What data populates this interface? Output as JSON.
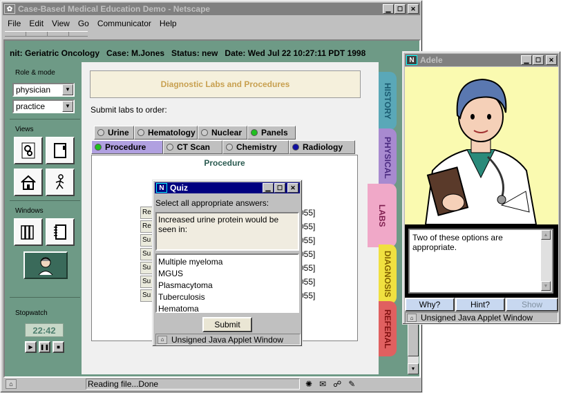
{
  "browser": {
    "title": "Case-Based Medical Education Demo - Netscape",
    "menu": [
      "File",
      "Edit",
      "View",
      "Go",
      "Communicator",
      "Help"
    ],
    "status_text": "Reading file...Done"
  },
  "case_info": "nit: Geriatric Oncology   Case: M.Jones   Status: new   Date: Wed Jul 22 10:27:11 PDT 1998",
  "sidebar": {
    "role_label": "Role & mode",
    "role_value": "physician",
    "mode_value": "practice",
    "views_label": "Views",
    "windows_label": "Windows",
    "stopwatch_label": "Stopwatch",
    "stopwatch_time": "22:42"
  },
  "main": {
    "heading": "Diagnostic Labs and Procedures",
    "instruction": "Submit labs to order:",
    "tabs_row1": [
      "Urine",
      "Hematology",
      "Nuclear",
      "Panels"
    ],
    "tabs_row2": [
      "Procedure",
      "CT Scan",
      "Chemistry",
      "Radiology"
    ],
    "panel_title": "Procedure",
    "panel_buttons": [
      "Re",
      "Re",
      "Su",
      "Su",
      "Su",
      "Su",
      "Su"
    ],
    "panel_codes": [
      "055]",
      "055]",
      "055]",
      "055]",
      "055]",
      "055]",
      "055]"
    ]
  },
  "vertical_tabs": [
    "HISTORY",
    "PHYSICAL",
    "LABS",
    "DIAGNOSIS",
    "REFERAL"
  ],
  "quiz": {
    "title": "Quiz",
    "prompt": "Select all appropriate answers:",
    "question": "Increased urine protein would be seen in:",
    "options": [
      "Multiple myeloma",
      "MGUS",
      "Plasmacytoma",
      "Tuberculosis",
      "Hematoma"
    ],
    "submit_label": "Submit",
    "status": "Unsigned Java Applet Window"
  },
  "adele": {
    "title": "Adele",
    "message": "Two of these options are appropriate.",
    "buttons": [
      "Why?",
      "Hint?",
      "Show"
    ],
    "status": "Unsigned Java Applet Window"
  },
  "colors": {
    "sidebar_green": "#6e9a86",
    "history_tab": "#5aa8b8",
    "physical_tab": "#a88ad0",
    "labs_tab": "#f0a8c8",
    "diagnosis_tab": "#f0e040",
    "referal_tab": "#e06060"
  }
}
